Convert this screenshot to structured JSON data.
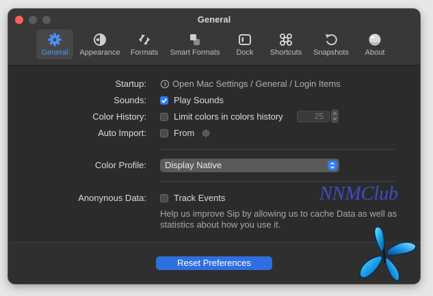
{
  "window": {
    "title": "General"
  },
  "tabs": [
    {
      "label": "General",
      "icon": "gear-icon",
      "active": true
    },
    {
      "label": "Appearance",
      "icon": "appearance-icon",
      "active": false
    },
    {
      "label": "Formats",
      "icon": "formats-icon",
      "active": false
    },
    {
      "label": "Smart Formats",
      "icon": "smart-formats-icon",
      "active": false
    },
    {
      "label": "Dock",
      "icon": "dock-icon",
      "active": false
    },
    {
      "label": "Shortcuts",
      "icon": "command-icon",
      "active": false
    },
    {
      "label": "Snapshots",
      "icon": "undo-arrow-icon",
      "active": false
    },
    {
      "label": "About",
      "icon": "about-icon",
      "active": false
    }
  ],
  "settings": {
    "startup": {
      "label": "Startup:",
      "link_text": "Open Mac Settings / General  / Login Items",
      "icon": "open-settings-icon"
    },
    "sounds": {
      "label": "Sounds:",
      "checkbox_label": "Play Sounds",
      "checked": true
    },
    "color_history": {
      "label": "Color History:",
      "checkbox_label": "Limit colors in colors history",
      "checked": false,
      "limit_value": "25"
    },
    "auto_import": {
      "label": "Auto Import:",
      "checkbox_label": "From",
      "checked": false,
      "icon": "gear-small-icon"
    },
    "color_profile": {
      "label": "Color Profile:",
      "selected": "Display Native"
    },
    "anonymous_data": {
      "label": "Anonynous Data:",
      "checkbox_label": "Track Events",
      "checked": false,
      "help_text": "Help us improve Sip by allowing us to cache Data as well as statistics about how you use it."
    }
  },
  "footer": {
    "reset_label": "Reset Preferences"
  },
  "watermark": {
    "text": "NNMClub"
  },
  "colors": {
    "accent": "#2f7df6",
    "window_bg": "#2b2b2b",
    "toolbar_bg": "#383838",
    "close_button": "#ff5f57"
  }
}
